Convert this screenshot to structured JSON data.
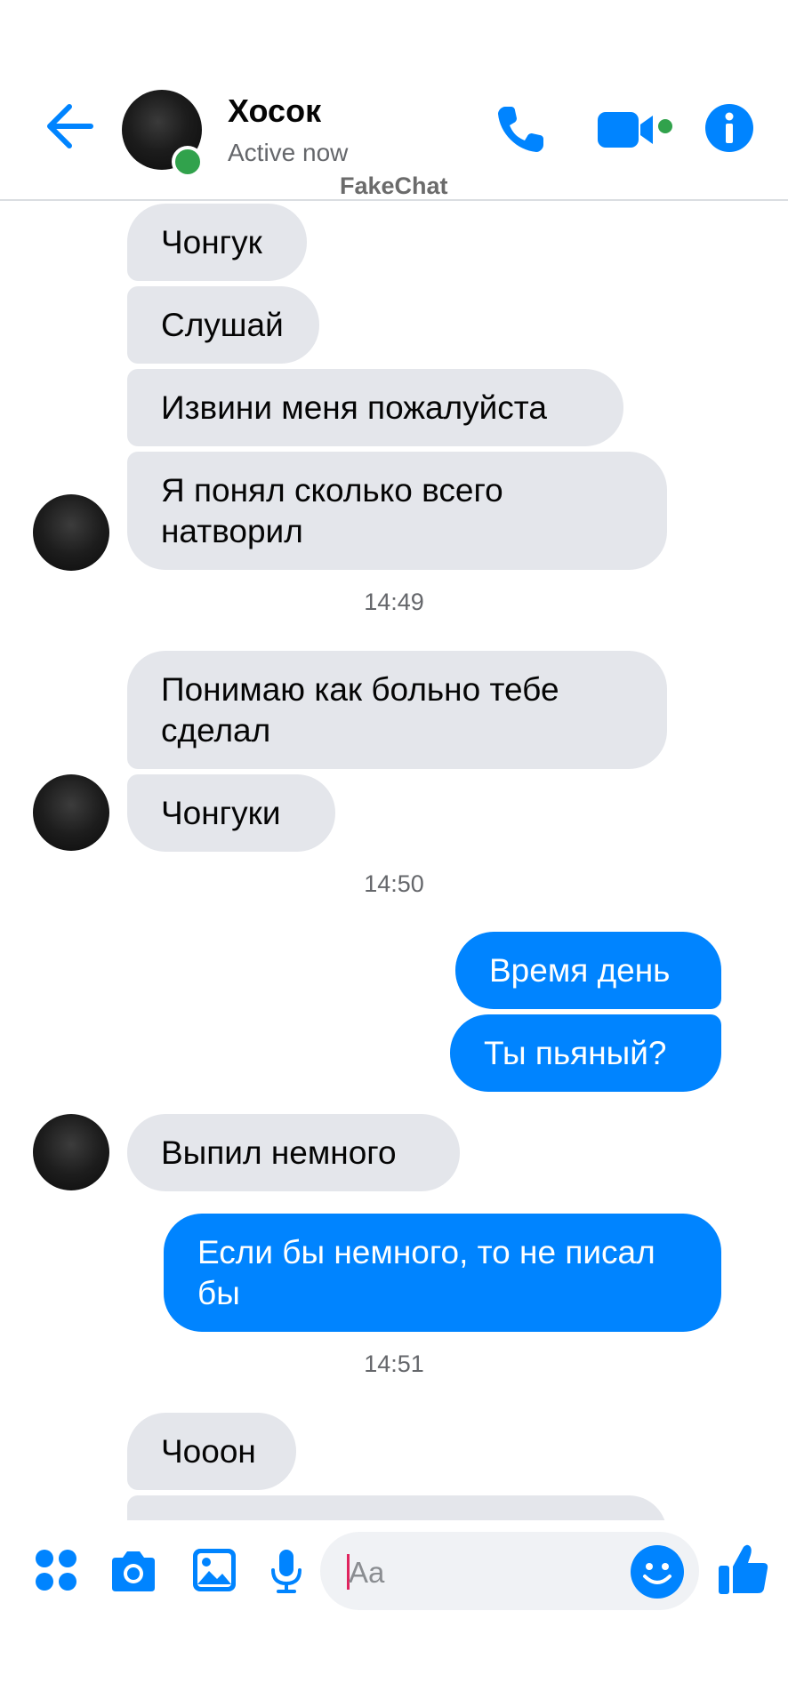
{
  "header": {
    "contact_name": "Хосок",
    "status": "Active now",
    "watermark": "FakeChat"
  },
  "conversation": [
    {
      "type": "received",
      "text": "Чонгук"
    },
    {
      "type": "received",
      "text": "Слушай"
    },
    {
      "type": "received",
      "text": "Извини меня пожалуйста"
    },
    {
      "type": "received",
      "text": "Я понял сколько всего\nнатворил"
    },
    {
      "type": "time",
      "text": "14:49"
    },
    {
      "type": "received",
      "text": "Понимаю как больно тебе\nсделал"
    },
    {
      "type": "received",
      "text": "Чонгуки"
    },
    {
      "type": "time",
      "text": "14:50"
    },
    {
      "type": "sent",
      "text": "Время день"
    },
    {
      "type": "sent",
      "text": "Ты пьяный?"
    },
    {
      "type": "received",
      "text": "Выпил немного"
    },
    {
      "type": "sent",
      "text": "Если бы немного, то не писал\nбы"
    },
    {
      "type": "time",
      "text": "14:51"
    },
    {
      "type": "received",
      "text": "Чооон"
    }
  ],
  "composer": {
    "placeholder": "Aa"
  },
  "colors": {
    "accent": "#0084ff",
    "received_bubble": "#e4e6eb",
    "online": "#31a24c"
  },
  "icons": [
    "back-arrow-icon",
    "phone-icon",
    "video-camera-icon",
    "info-icon",
    "apps-icon",
    "camera-icon",
    "gallery-icon",
    "microphone-icon",
    "emoji-icon",
    "thumbs-up-icon"
  ]
}
